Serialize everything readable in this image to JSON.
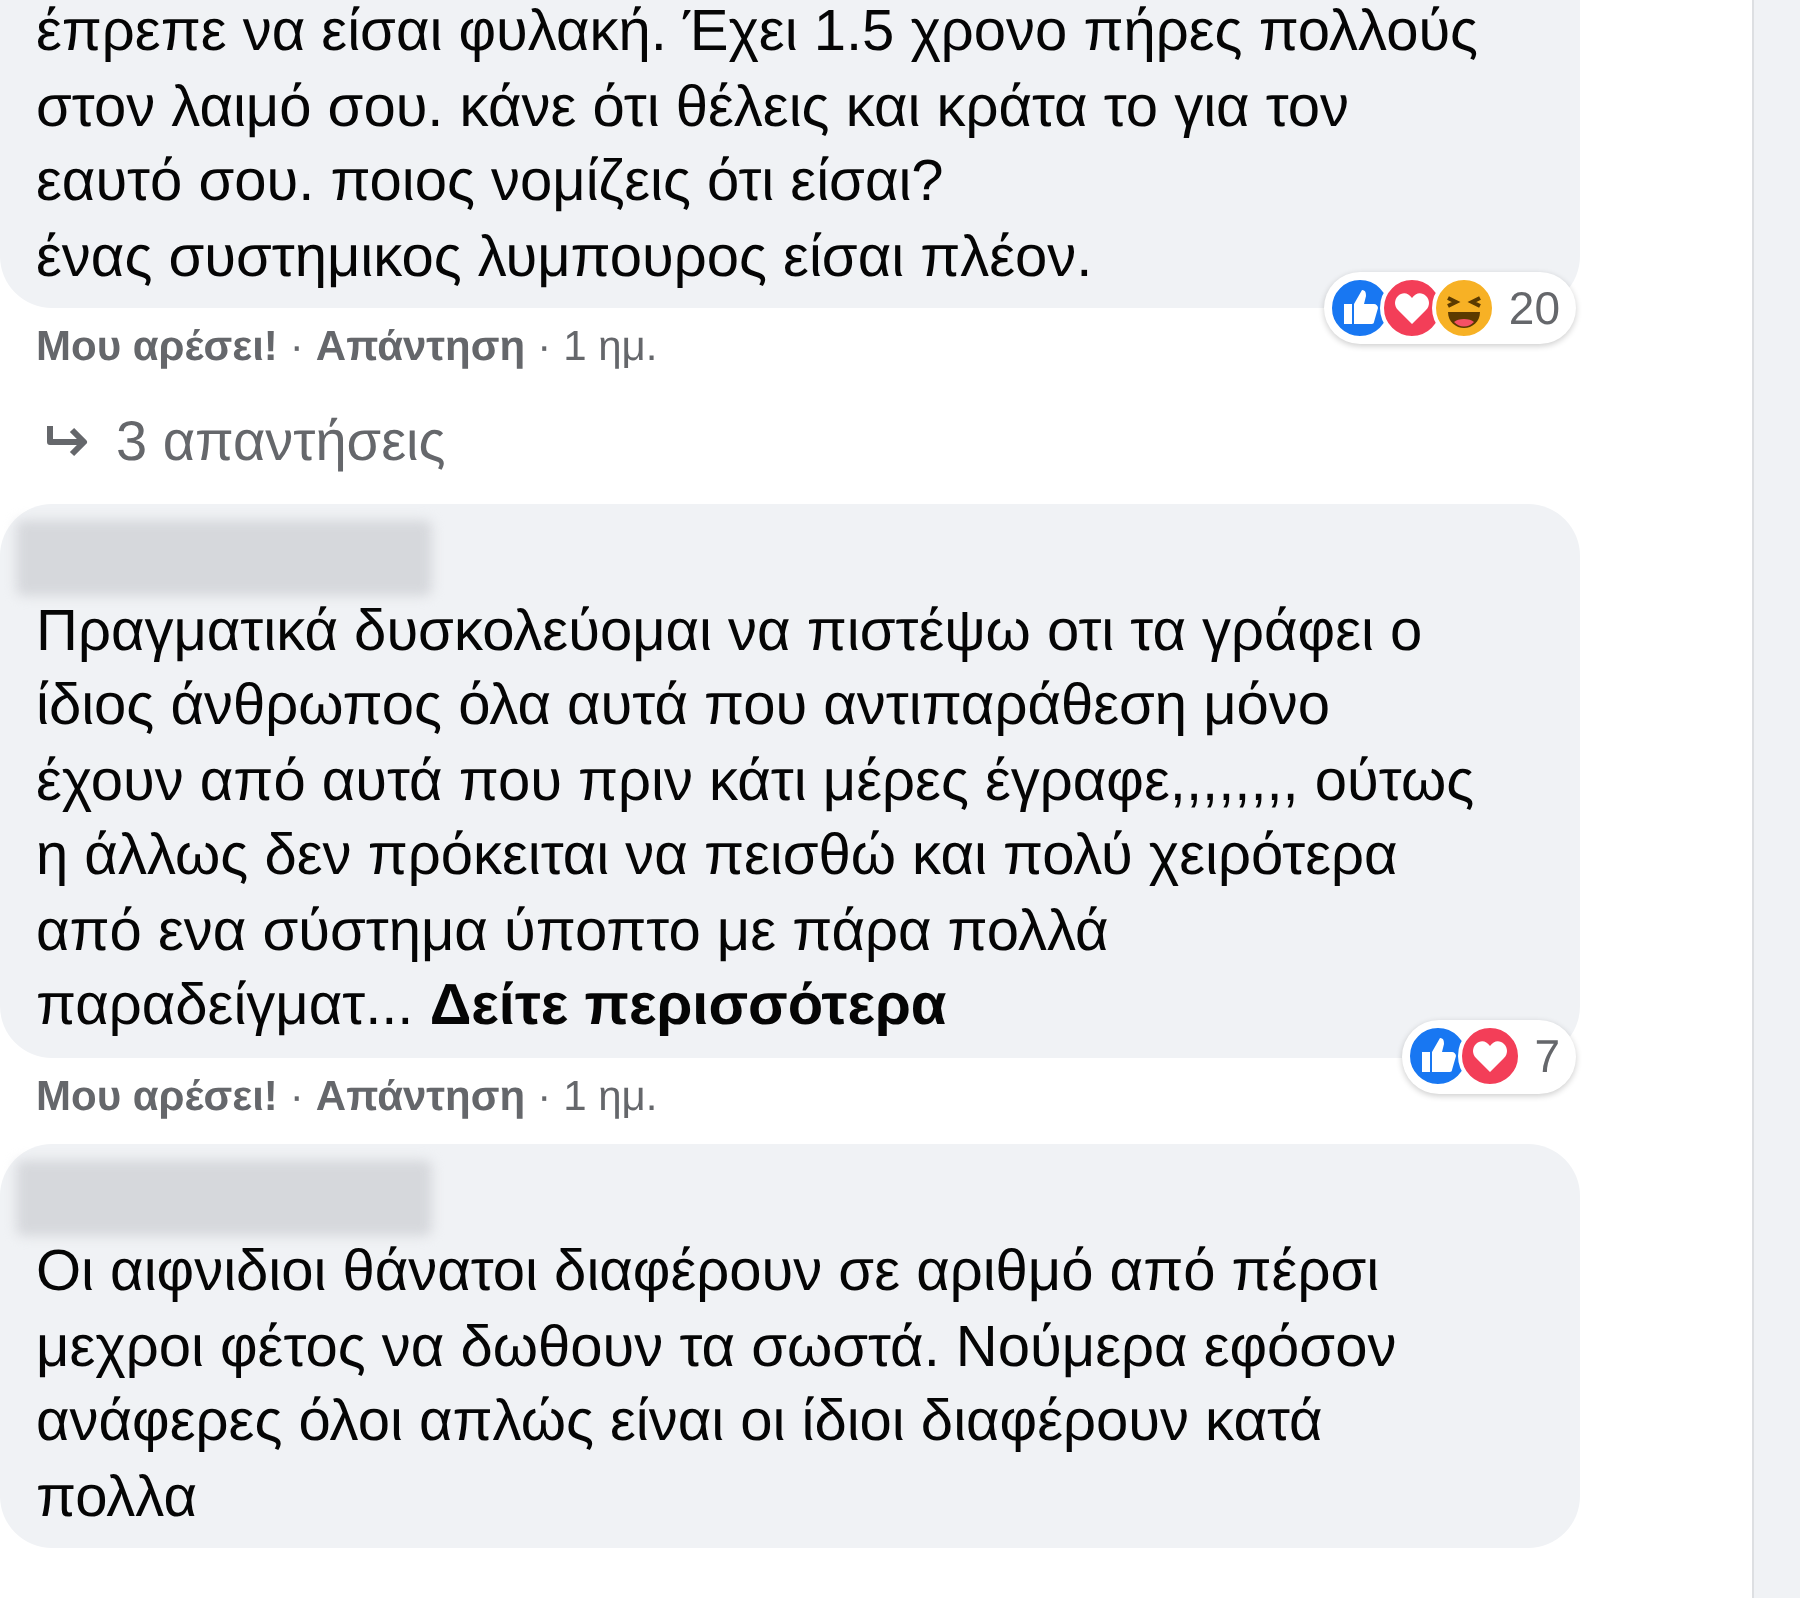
{
  "comments": [
    {
      "name_hidden": false,
      "text": "έπρεπε να είσαι φυλακή. Έχει 1.5 χρονο πήρες πολλούς\nστον λαιμό σου. κάνε ότι θέλεις και κράτα το για τον\nεαυτό σου. ποιος νομίζεις ότι είσαι?\nένας συστημικος λυμπουρος είσαι πλέον.",
      "reactions": {
        "icons": [
          {
            "kind": "like"
          },
          {
            "kind": "love"
          },
          {
            "kind": "haha"
          }
        ],
        "count": "20"
      },
      "actions": {
        "like": "Μου αρέσει!",
        "sep_1": "·",
        "reply": "Απάντηση",
        "sep_2": "·",
        "time": "1 ημ."
      },
      "replies": "3 απαντήσεις"
    },
    {
      "name_hidden": true,
      "text": "Πραγματικά δυσκολεύομαι να πιστέψω οτι τα γράφει ο\nίδιος άνθρωπος όλα αυτά που αντιπαράθεση μόνο\nέχουν από αυτά που πριν κάτι μέρες έγραφε,,,,,,,, ούτως\nη άλλως δεν πρόκειται να πεισθώ και πολύ χειρότερα\nαπό ενα σύστημα ύποπτο με πάρα πολλά\nπαραδείγματ...",
      "see_more": "Δείτε περισσότερα",
      "reactions": {
        "icons": [
          {
            "kind": "like"
          },
          {
            "kind": "love"
          }
        ],
        "count": "7"
      },
      "actions": {
        "like": "Μου αρέσει!",
        "sep_1": "·",
        "reply": "Απάντηση",
        "sep_2": "·",
        "time": "1 ημ."
      }
    },
    {
      "name_hidden": true,
      "text": "Οι αιφνιδιοι θάνατοι διαφέρουν σε αριθμό από πέρσι\nμεχροι φέτος να δωθουν τα σωστά. Νούμερα εφόσον\nανάφερες όλοι απλώς είναι οι ίδιοι διαφέρουν κατά\nπολλα"
    }
  ]
}
